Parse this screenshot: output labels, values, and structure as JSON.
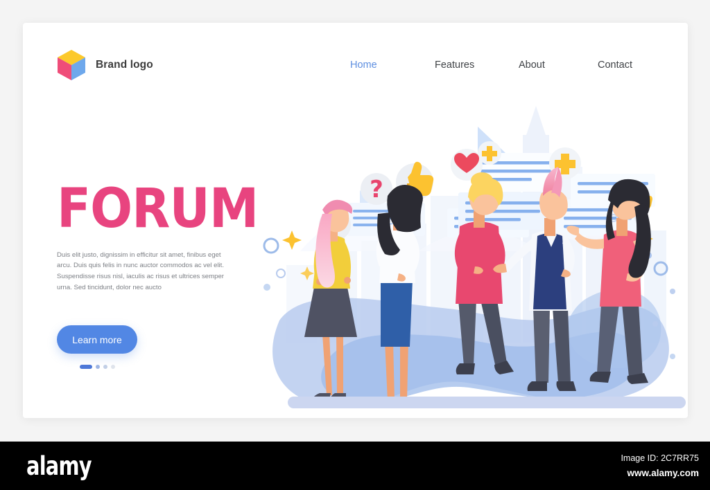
{
  "page": {
    "background_color": "#f4f4f4",
    "card_background": "#ffffff"
  },
  "header": {
    "brand": {
      "logo_icon": "cube-logo-icon",
      "name": "Brand logo",
      "colors": {
        "top": "#fcc92b",
        "left": "#ef4d79",
        "right": "#6ea8ec"
      }
    },
    "nav": {
      "items": [
        {
          "label": "Home",
          "active": true
        },
        {
          "label": "Features",
          "active": false
        },
        {
          "label": "About",
          "active": false
        },
        {
          "label": "Contact",
          "active": false
        }
      ],
      "active_color": "#5e8fe0",
      "inactive_color": "#3f4246"
    }
  },
  "hero": {
    "title": "FORUM",
    "title_color": "#e8447f",
    "body": "Duis elit justo, dignissim in efficitur sit amet, finibus eget arcu. Duis quis felis in nunc auctor commodos ac vel elit. Suspendisse risus nisl, iaculis ac risus et ultrices semper urna. Sed tincidunt, dolor nec aucto",
    "cta_label": "Learn more",
    "cta_color": "#5287e4",
    "carousel": {
      "active_index": 0,
      "total": 4
    }
  },
  "illustration": {
    "name": "forum-discussion-illustration",
    "badges": [
      {
        "icon": "heart-icon",
        "color": "#ec4a5e"
      },
      {
        "icon": "question-mark-icon",
        "color": "#e8446d"
      },
      {
        "icon": "thumbs-up-icon",
        "color": "#fcc230"
      },
      {
        "icon": "heart-icon",
        "color": "#ec4a5e"
      },
      {
        "icon": "plus-icon",
        "color": "#fcc230"
      },
      {
        "icon": "plus-icon",
        "color": "#fcc230"
      },
      {
        "icon": "thumbs-up-icon",
        "color": "#fcc230"
      }
    ],
    "chat_bubbles": 6,
    "characters": [
      {
        "name": "woman-pink-hair",
        "top_color": "#f2ce3b",
        "bottom_color": "#4f5263"
      },
      {
        "name": "woman-black-hair",
        "top_color": "#ffffff",
        "bottom_color": "#2f5fa8"
      },
      {
        "name": "person-blonde",
        "top_color": "#e8486f",
        "bottom_color": "#555a6b"
      },
      {
        "name": "person-pink-mohawk",
        "top_color": "#2c3f7e",
        "bottom_color": "#5a5f70"
      },
      {
        "name": "woman-dark-hair",
        "top_color": "#f0607a",
        "bottom_color": "#596075"
      }
    ],
    "ground_color": "#ccd6f0"
  },
  "watermark_footer": {
    "logo": "alamy",
    "image_id": "Image ID: 2C7RR75",
    "url": "www.alamy.com",
    "background": "#000000"
  }
}
